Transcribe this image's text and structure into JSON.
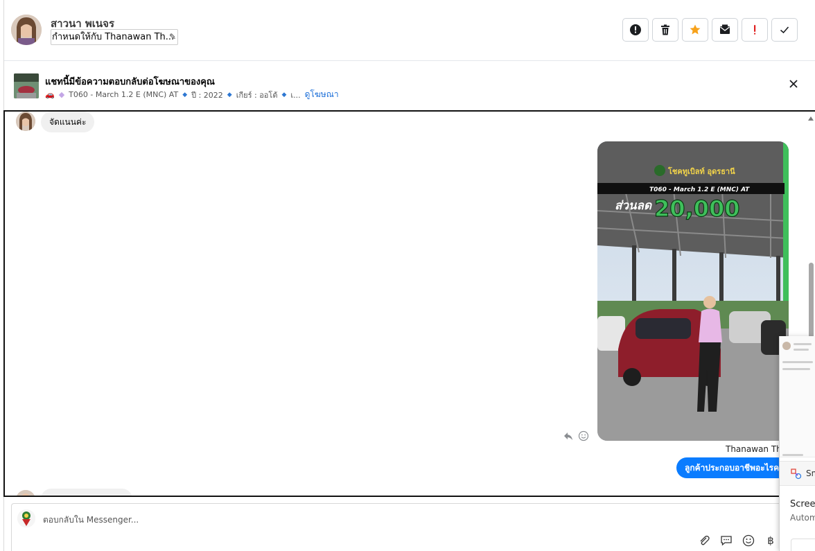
{
  "header": {
    "contact_name": "สาวนา พเนจร",
    "assign_text": "กำหนดให้กับ Thanawan Th...",
    "actions": [
      {
        "icon": "alert-circle-icon",
        "color": "#1c1e21"
      },
      {
        "icon": "trash-icon",
        "color": "#1c1e21"
      },
      {
        "icon": "star-icon",
        "color": "#f7a21b"
      },
      {
        "icon": "mail-block-icon",
        "color": "#1c1e21"
      },
      {
        "icon": "exclamation-icon",
        "color": "#e02020"
      },
      {
        "icon": "check-icon",
        "color": "#1c1e21"
      }
    ]
  },
  "ad_banner": {
    "title": "แชทนี้มีข้อความตอบกลับต่อโฆษณาของคุณ",
    "emoji": "🚗",
    "diamond": "◆",
    "model": "T060 - March 1.2 E (MNC) AT",
    "year": "ปี : 2022",
    "gear": "เกียร์ : ออโต้",
    "ellipsis": "เ...",
    "view_ad_link": "ดูโฆษณา"
  },
  "conversation": {
    "incoming_top": "จัดแนนค่ะ",
    "media_card": {
      "brand_text": "โชคทูเบิลท์ อุดรธานี",
      "model_banner": "T060 - March 1.2 E (MNC) AT",
      "discount_label": "ส่วนลด",
      "discount_value": "20,000",
      "accent_color": "#3fbf5b"
    },
    "sender_name": "Thanawan Tho",
    "outgoing_message": "ลูกค้าประกอบอาชีพอะไรคะ"
  },
  "composer": {
    "placeholder": "ตอบกลับใน Messenger...",
    "tools": [
      "attach-icon",
      "saved-reply-icon",
      "emoji-icon",
      "baht-icon"
    ]
  },
  "overlay": {
    "sm_label": "Sm",
    "title": "Screen",
    "subtitle": "Autom"
  },
  "colors": {
    "messenger_blue": "#0a7cff",
    "link_blue": "#1b6ed8"
  }
}
